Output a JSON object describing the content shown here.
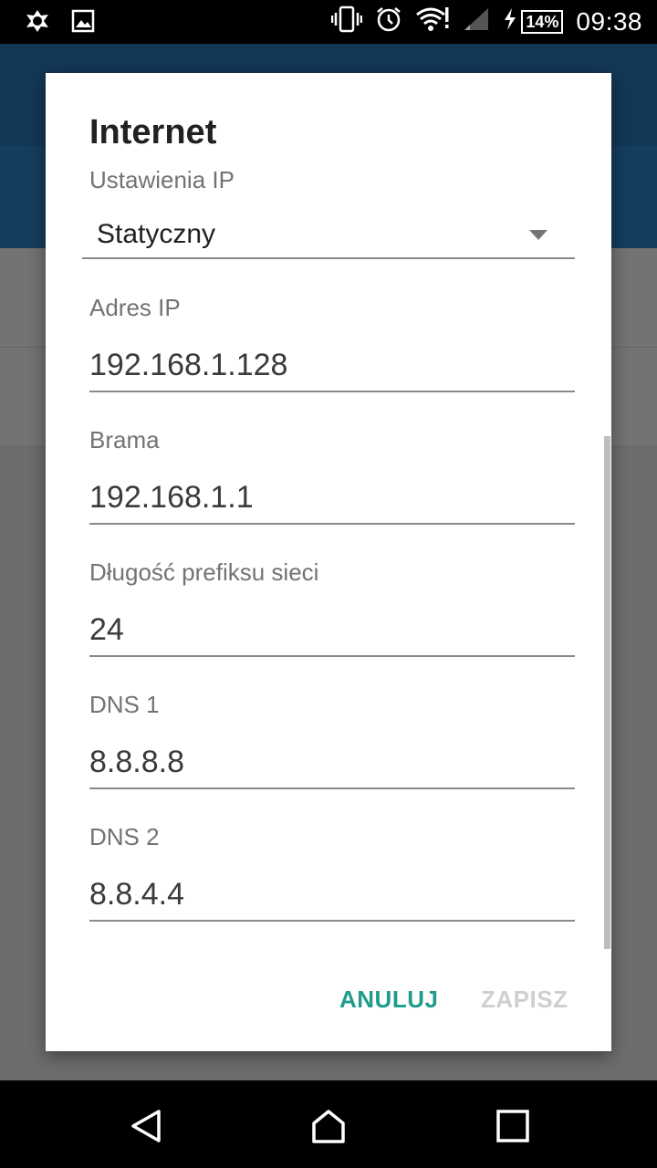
{
  "status_bar": {
    "battery": "14%",
    "time": "09:38",
    "icons": [
      "avast-icon",
      "image-icon",
      "vibrate-icon",
      "alarm-icon",
      "wifi-alert-icon",
      "signal-icon",
      "charging-icon",
      "battery-icon"
    ]
  },
  "dialog": {
    "title": "Internet",
    "ip_settings": {
      "label": "Ustawienia IP",
      "value": "Statyczny"
    },
    "fields": [
      {
        "label": "Adres IP",
        "value": "192.168.1.128"
      },
      {
        "label": "Brama",
        "value": "192.168.1.1"
      },
      {
        "label": "Długość prefiksu sieci",
        "value": "24"
      },
      {
        "label": "DNS 1",
        "value": "8.8.8.8"
      },
      {
        "label": "DNS 2",
        "value": "8.8.4.4"
      }
    ],
    "buttons": {
      "cancel": "ANULUJ",
      "save": "ZAPISZ"
    }
  },
  "colors": {
    "accent": "#1f9c8c",
    "app_bar": "#2a7bbf",
    "disabled": "#cfcfcf"
  },
  "navigation": {
    "icons": [
      "back-icon",
      "home-icon",
      "recents-icon"
    ]
  }
}
